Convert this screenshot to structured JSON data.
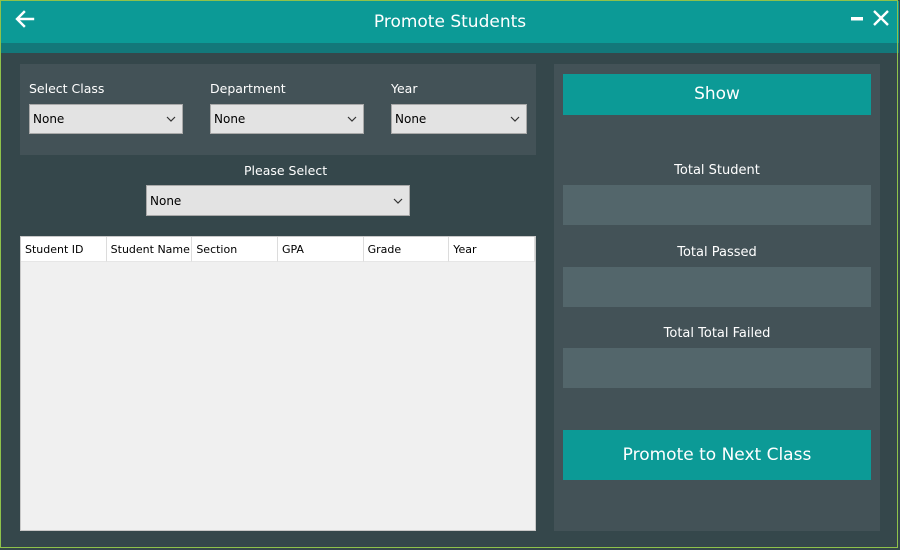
{
  "window": {
    "title": "Promote Students",
    "back_icon": "arrow-left-icon",
    "minimize_icon": "minimize-icon",
    "close_icon": "close-icon"
  },
  "filters": {
    "select_class": {
      "label": "Select Class",
      "value": "None"
    },
    "department": {
      "label": "Department",
      "value": "None"
    },
    "year": {
      "label": "Year",
      "value": "None"
    },
    "please_select": {
      "label": "Please Select",
      "value": "None"
    }
  },
  "table": {
    "columns": [
      "Student ID",
      "Student Name",
      "Section",
      "GPA",
      "Grade",
      "Year"
    ],
    "rows": []
  },
  "side": {
    "show_label": "Show",
    "total_student_label": "Total Student",
    "total_student_value": "",
    "total_passed_label": "Total Passed",
    "total_passed_value": "",
    "total_failed_label": "Total Total Failed",
    "total_failed_value": "",
    "promote_label": "Promote to Next Class"
  },
  "colors": {
    "accent": "#0c9a96",
    "background": "#35474b",
    "panel": "#435257",
    "stat_box": "#53666b"
  }
}
